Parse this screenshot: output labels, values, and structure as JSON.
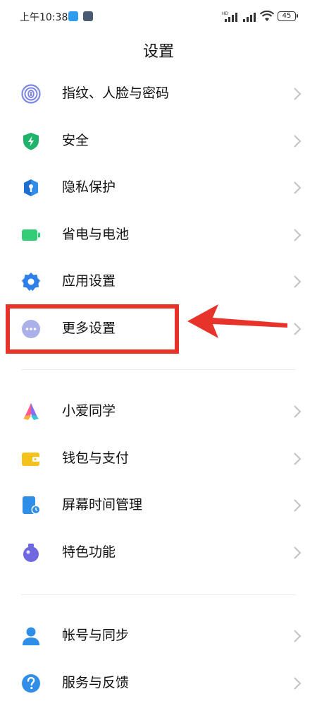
{
  "status_bar": {
    "time": "上午10:38",
    "battery": "45",
    "network_tag": "HD"
  },
  "header": {
    "title": "设置"
  },
  "group1": [
    {
      "label": "指纹、人脸与密码",
      "icon": "fingerprint-icon"
    },
    {
      "label": "安全",
      "icon": "security-shield-icon"
    },
    {
      "label": "隐私保护",
      "icon": "privacy-icon"
    },
    {
      "label": "省电与电池",
      "icon": "battery-icon"
    },
    {
      "label": "应用设置",
      "icon": "gear-icon"
    },
    {
      "label": "更多设置",
      "icon": "more-dots-icon"
    }
  ],
  "group2": [
    {
      "label": "小爱同学",
      "icon": "xiaoai-icon"
    },
    {
      "label": "钱包与支付",
      "icon": "wallet-icon"
    },
    {
      "label": "屏幕时间管理",
      "icon": "screen-time-icon"
    },
    {
      "label": "特色功能",
      "icon": "special-features-icon"
    }
  ],
  "group3": [
    {
      "label": "帐号与同步",
      "icon": "account-icon"
    },
    {
      "label": "服务与反馈",
      "icon": "help-icon"
    }
  ],
  "colors": {
    "annotation_red": "#e8332b",
    "security_green": "#1fb36b",
    "privacy_blue": "#2f8fe8",
    "battery_green": "#33cc77",
    "gear_blue": "#2f7fe8",
    "more_purple": "#a9b1e8",
    "wallet_yellow": "#f5c21b",
    "account_blue": "#2f8fe8"
  }
}
